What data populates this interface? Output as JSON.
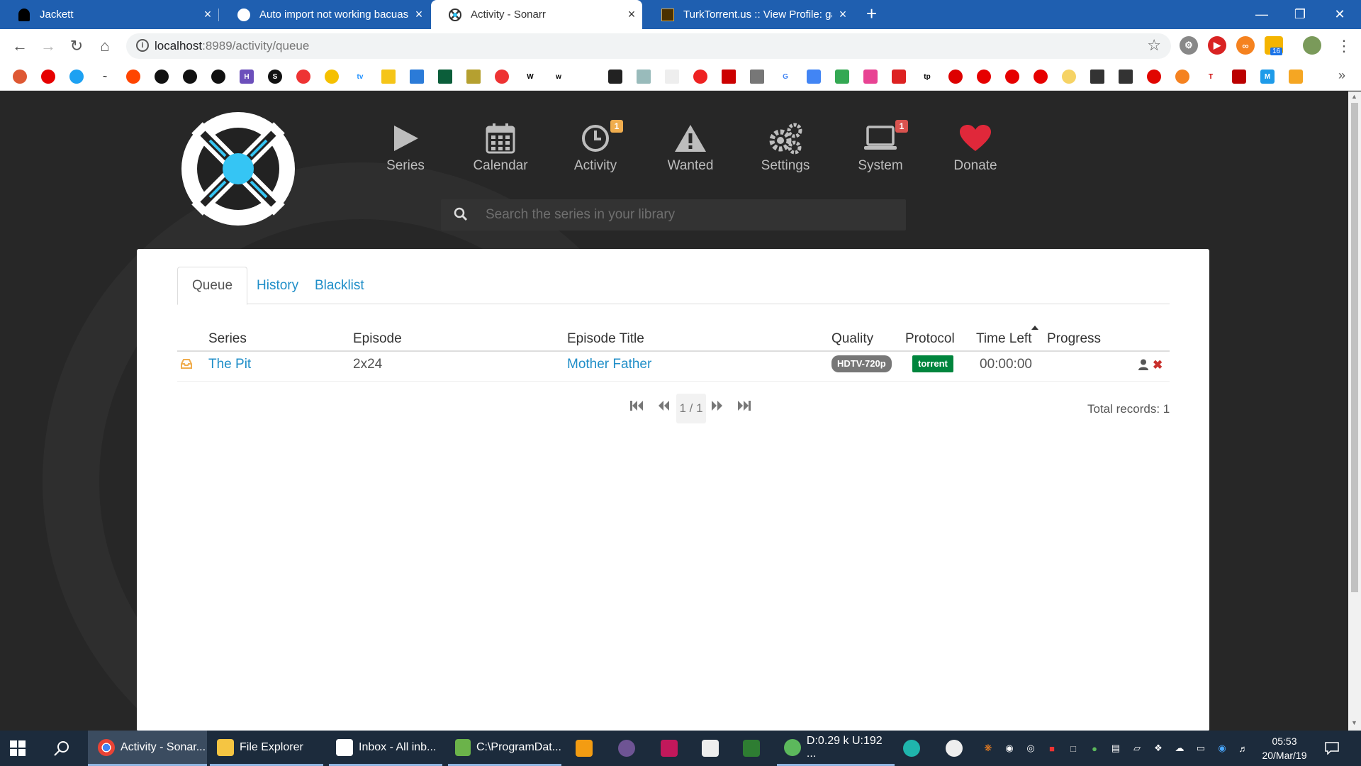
{
  "browser": {
    "tabs": [
      {
        "title": "Jackett",
        "close": "×"
      },
      {
        "title": "Auto import not working bacuase",
        "close": "×"
      },
      {
        "title": "Activity - Sonarr",
        "close": "×"
      },
      {
        "title": "TurkTorrent.us :: View Profile: gar",
        "close": "×"
      }
    ],
    "new_tab": "+",
    "url_host": "localhost",
    "url_rest": ":8989/activity/queue",
    "extension_badge": "16"
  },
  "sonarr": {
    "nav": [
      {
        "label": "Series",
        "icon": "play-icon"
      },
      {
        "label": "Calendar",
        "icon": "calendar-icon"
      },
      {
        "label": "Activity",
        "icon": "clock-icon",
        "badge": "1",
        "badge_color": "#f0ad4e"
      },
      {
        "label": "Wanted",
        "icon": "warning-icon"
      },
      {
        "label": "Settings",
        "icon": "gears-icon"
      },
      {
        "label": "System",
        "icon": "laptop-icon",
        "badge": "1",
        "badge_color": "#d9534f"
      },
      {
        "label": "Donate",
        "icon": "heart-icon"
      }
    ],
    "search": {
      "placeholder": "Search the series in your library"
    },
    "tabs": [
      {
        "label": "Queue",
        "active": true
      },
      {
        "label": "History",
        "active": false
      },
      {
        "label": "Blacklist",
        "active": false
      }
    ],
    "columns": {
      "series": "Series",
      "episode": "Episode",
      "episode_title": "Episode Title",
      "quality": "Quality",
      "protocol": "Protocol",
      "time_left": "Time Left",
      "progress": "Progress"
    },
    "rows": [
      {
        "series": "The Pit",
        "episode": "2x24",
        "episode_title": "Mother Father",
        "quality": "HDTV-720p",
        "protocol": "torrent",
        "time_left": "00:00:00"
      }
    ],
    "pager": {
      "page": "1 / 1",
      "total": "Total records: 1"
    },
    "colors": {
      "link": "#1f8ec8",
      "quality_bg": "#777777",
      "protocol_bg": "#00853d",
      "remove": "#c9302c"
    }
  },
  "taskbar": {
    "apps": [
      {
        "label": "Activity - Sonar..."
      },
      {
        "label": "File Explorer"
      },
      {
        "label": "Inbox - All inb..."
      },
      {
        "label": "C:\\ProgramDat..."
      },
      {
        "label": "D:0.29 k U:192 ..."
      }
    ],
    "time": "05:53",
    "date": "20/Mar/19"
  }
}
